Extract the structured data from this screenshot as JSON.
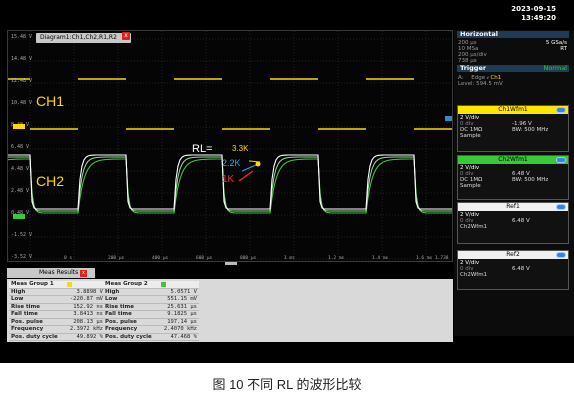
{
  "datetime": {
    "date": "2023-09-15",
    "time": "13:49:20"
  },
  "diagram": {
    "title": "Diagram1:Ch1,Ch2,R1,R2",
    "close": "x",
    "y_labels": [
      "15.48 V",
      "14.48 V",
      "12.48 V",
      "10.48 V",
      "8.48 V",
      "6.48 V",
      "4.48 V",
      "2.48 V",
      "0.48 V",
      "-1.52 V",
      "-3.52 V"
    ],
    "x_labels": [
      "0 s",
      "200 µs",
      "400 µs",
      "600 µs",
      "800 µs",
      "1 ms",
      "1.2 ms",
      "1.4 ms",
      "1.6 ms 1.738 ms"
    ]
  },
  "annotations": {
    "ch1": "CH1",
    "ch2": "CH2",
    "rl": "RL=",
    "r33k": "3.3K",
    "r22k": "2.2K",
    "r1k": "1K"
  },
  "colors": {
    "ch1": "#ffd800",
    "ch2": "#38c838",
    "ref": "#ffffff",
    "r1k": "#ff2a2a",
    "r22k": "#25a8ff"
  },
  "horizontal": {
    "title": "Horizontal",
    "rows": [
      {
        "l": "200 µs",
        "r": "5 GSa/s"
      },
      {
        "l": "10 MSa",
        "r": "RT"
      },
      {
        "l": "200 µs/div",
        "r": ""
      },
      {
        "l": "738 µs",
        "r": ""
      }
    ]
  },
  "trigger": {
    "title": "Trigger",
    "mode": "Normal",
    "a_label": "A:",
    "edge": "Edge",
    "source": "Ch1",
    "level": "Level: 594.5 mV"
  },
  "wfms": [
    {
      "title": "Ch1Wfm1",
      "l1": "2 V/div",
      "l2": "0 div",
      "r2": "-1.96 V",
      "l3": "DC 1MΩ",
      "r3": "BW: 500 MHz",
      "l4": "Sample"
    },
    {
      "title": "Ch2Wfm1",
      "l1": "2 V/div",
      "l2": "0 div",
      "r2": "6.48 V",
      "l3": "DC 1MΩ",
      "r3": "BW: 500 MHz",
      "l4": "Sample"
    },
    {
      "title": "Ref1",
      "l1": "2 V/div",
      "l2": "0 div",
      "r2": "6.48 V",
      "l3": "Ch2Wfm1",
      "r3": "",
      "l4": ""
    },
    {
      "title": "Ref2",
      "l1": "2 V/div",
      "l2": "0 div",
      "r2": "6.48 V",
      "l3": "Ch2Wfm1",
      "r3": "",
      "l4": ""
    }
  ],
  "meas": {
    "tab": "Meas Results",
    "close": "x",
    "group1": {
      "title": "Meas Group 1",
      "rows": [
        {
          "k": "High",
          "v": "3.8898 V"
        },
        {
          "k": "Low",
          "v": "-220.87 mV"
        },
        {
          "k": "Rise time",
          "v": "152.92 ns"
        },
        {
          "k": "Fall time",
          "v": "3.8413 ns"
        },
        {
          "k": "Pos. pulse",
          "v": "208.13 µs"
        },
        {
          "k": "Frequency",
          "v": "2.3972 kHz"
        },
        {
          "k": "Pos. duty cycle",
          "v": "49.892 %"
        }
      ]
    },
    "group2": {
      "title": "Meas Group 2",
      "rows": [
        {
          "k": "High",
          "v": "5.0571 V"
        },
        {
          "k": "Low",
          "v": "551.15 mV"
        },
        {
          "k": "Rise time",
          "v": "25.631 µs"
        },
        {
          "k": "Fall time",
          "v": "9.1825 µs"
        },
        {
          "k": "Pos. pulse",
          "v": "197.14 µs"
        },
        {
          "k": "Frequency",
          "v": "2.4070 kHz"
        },
        {
          "k": "Pos. duty cycle",
          "v": "47.468 %"
        }
      ]
    }
  },
  "caption": "图 10  不同 RL 的波形比较"
}
